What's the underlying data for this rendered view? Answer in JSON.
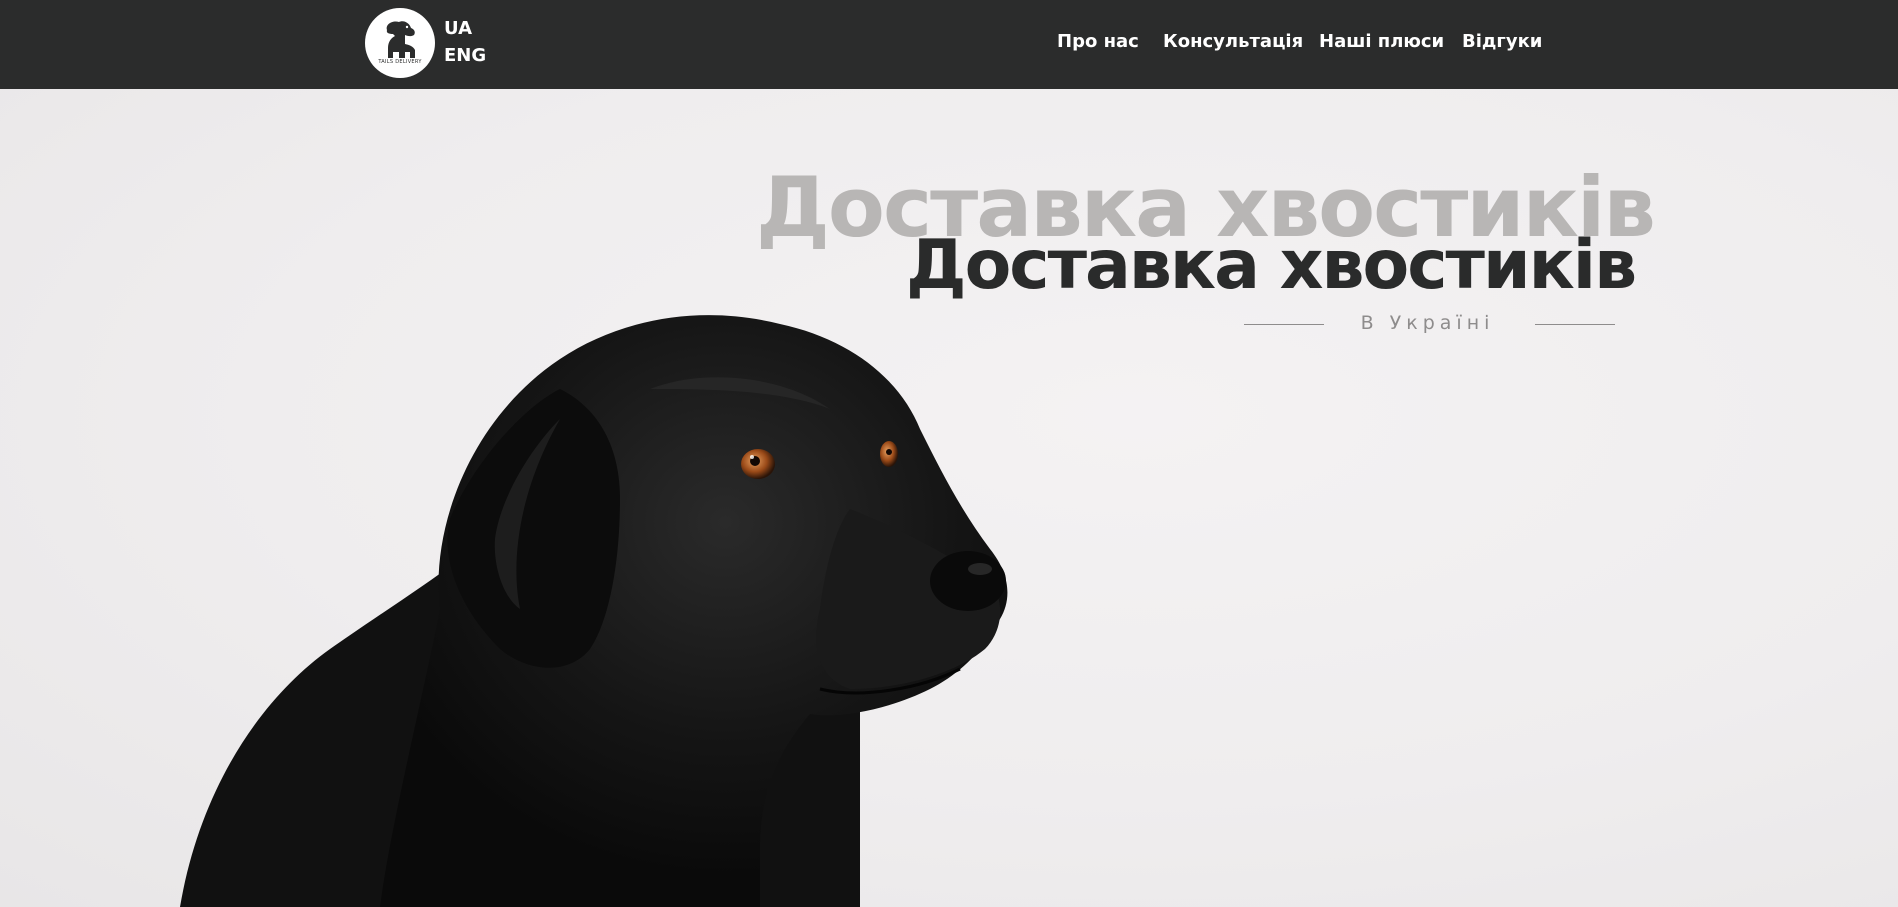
{
  "header": {
    "logo_text": "TAILS DELIVERY",
    "languages": [
      "UA",
      "ENG"
    ],
    "nav": [
      "Про нас",
      "Консультація",
      "Наші плюси",
      "Відгуки"
    ],
    "background_color": "#2b2c2c"
  },
  "hero": {
    "title_shadow": "Доставка хвостиків",
    "title": "Доставка хвостиків",
    "subtitle": "В Україні",
    "image": "black-labrador-dog-photo",
    "colors": {
      "title": "#2a2b2b",
      "title_shadow": "#b8b6b5",
      "subtitle": "#8e8c8c"
    }
  }
}
